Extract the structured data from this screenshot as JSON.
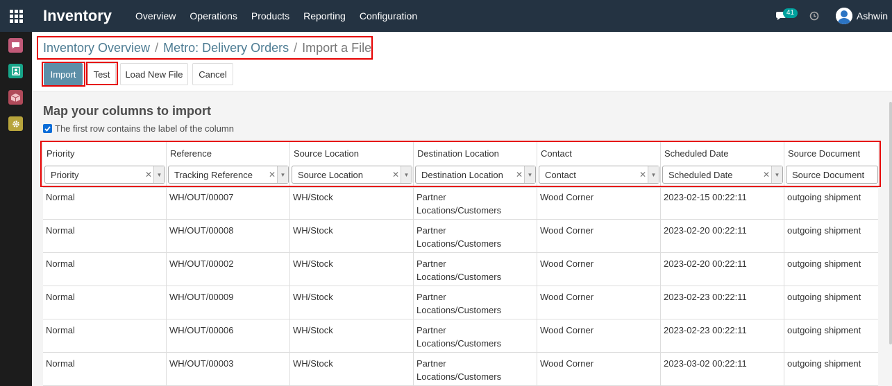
{
  "app": {
    "title": "Inventory",
    "menu": [
      "Overview",
      "Operations",
      "Products",
      "Reporting",
      "Configuration"
    ],
    "notification_count": "41",
    "username": "Ashwin"
  },
  "breadcrumb": {
    "items": [
      "Inventory Overview",
      "Metro: Delivery Orders"
    ],
    "separator": "/",
    "current": "Import a File"
  },
  "buttons": {
    "import": "Import",
    "test": "Test",
    "load_new": "Load New File",
    "cancel": "Cancel"
  },
  "mapping": {
    "title": "Map your columns to import",
    "first_row_label": "The first row contains the label of the column",
    "first_row_checked": true
  },
  "columns": [
    {
      "header": "Priority",
      "field": "Priority"
    },
    {
      "header": "Reference",
      "field": "Tracking Reference"
    },
    {
      "header": "Source Location",
      "field": "Source Location"
    },
    {
      "header": "Destination Location",
      "field": "Destination Location"
    },
    {
      "header": "Contact",
      "field": "Contact"
    },
    {
      "header": "Scheduled Date",
      "field": "Scheduled Date"
    },
    {
      "header": "Source Document",
      "field": "Source Document"
    }
  ],
  "rows": [
    [
      "Normal",
      "WH/OUT/00007",
      "WH/Stock",
      "Partner\nLocations/Customers",
      "Wood Corner",
      "2023-02-15 00:22:11",
      "outgoing shipment"
    ],
    [
      "Normal",
      "WH/OUT/00008",
      "WH/Stock",
      "Partner\nLocations/Customers",
      "Wood Corner",
      "2023-02-20 00:22:11",
      "outgoing shipment"
    ],
    [
      "Normal",
      "WH/OUT/00002",
      "WH/Stock",
      "Partner\nLocations/Customers",
      "Wood Corner",
      "2023-02-20 00:22:11",
      "outgoing shipment"
    ],
    [
      "Normal",
      "WH/OUT/00009",
      "WH/Stock",
      "Partner\nLocations/Customers",
      "Wood Corner",
      "2023-02-23 00:22:11",
      "outgoing shipment"
    ],
    [
      "Normal",
      "WH/OUT/00006",
      "WH/Stock",
      "Partner\nLocations/Customers",
      "Wood Corner",
      "2023-02-23 00:22:11",
      "outgoing shipment"
    ],
    [
      "Normal",
      "WH/OUT/00003",
      "WH/Stock",
      "Partner\nLocations/Customers",
      "Wood Corner",
      "2023-03-02 00:22:11",
      "outgoing shipment"
    ]
  ],
  "colors": {
    "navbar": "#243342",
    "primary": "#5d8fa8",
    "highlight": "#e60000",
    "link": "#4d7c93",
    "badge": "#00a09d"
  },
  "icons": {
    "apps": "grid-icon",
    "chat": "chat-icon",
    "clock": "clock-icon",
    "left_apps": [
      "discuss-icon",
      "contacts-icon",
      "inventory-icon",
      "settings-icon"
    ]
  }
}
